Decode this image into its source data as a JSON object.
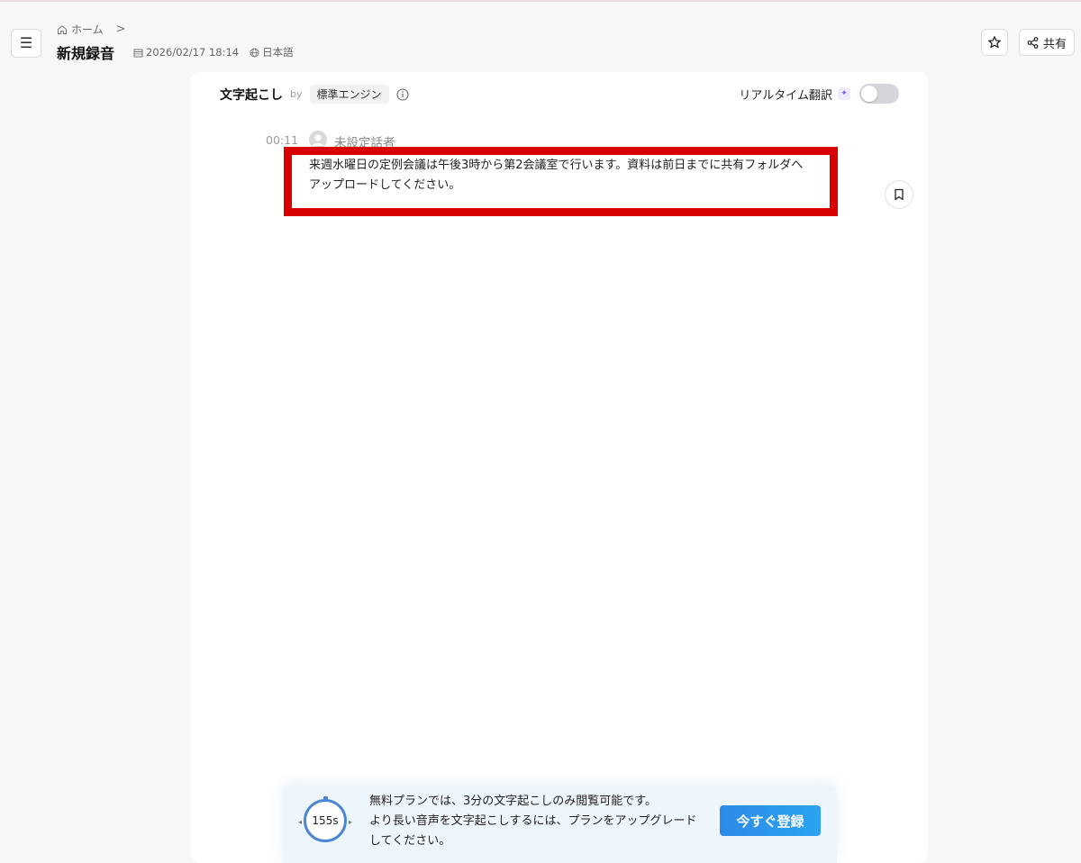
{
  "header": {
    "breadcrumb_home": "ホーム",
    "title": "新規録音",
    "date": "2026/02/17 18:14",
    "language": "日本語",
    "share_label": "共有"
  },
  "transcript": {
    "title": "文字起こし",
    "by": "by",
    "engine": "標準エンジン",
    "realtime_translate": "リアルタイム翻訳",
    "realtime_enabled": false,
    "segments": [
      {
        "time": "00:11",
        "speaker": "未設定話者",
        "text": "来週水曜日の定例会議は午後3時から第2会議室で行います。資料は前日までに共有フォルダへアップロードしてください。"
      }
    ]
  },
  "promo": {
    "timer": "155s",
    "line1": "無料プランでは、3分の文字起こしのみ閲覧可能です。",
    "line2": "より長い音声を文字起こしするには、プランをアップグレードしてください。",
    "button": "今すぐ登録"
  },
  "colors": {
    "highlight": "#d90000",
    "accent": "#2d8be8"
  }
}
